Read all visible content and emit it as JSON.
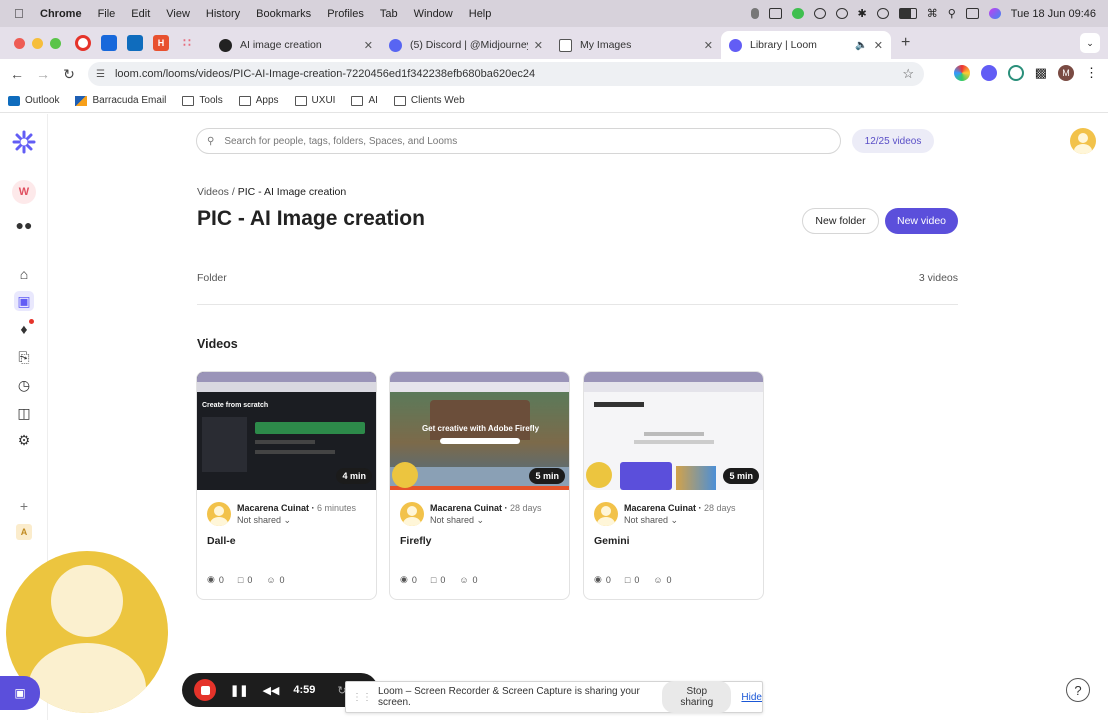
{
  "menubar": {
    "app": "Chrome",
    "items": [
      "File",
      "Edit",
      "View",
      "History",
      "Bookmarks",
      "Profiles",
      "Tab",
      "Window",
      "Help"
    ],
    "datetime": "Tue 18 Jun  09:46"
  },
  "tabs": [
    {
      "title": "AI image creation",
      "favicon_color": "#222222"
    },
    {
      "title": "(5) Discord | @Midjourney Bo",
      "favicon_color": "#5865f2"
    },
    {
      "title": "My Images",
      "favicon_color": "#555555"
    },
    {
      "title": "Library | Loom",
      "favicon_color": "#625df5",
      "active": true
    }
  ],
  "address": {
    "url": "loom.com/looms/videos/PIC-AI-Image-creation-7220456ed1f342238efb680ba620ec24"
  },
  "bookmarks": [
    {
      "label": "Outlook",
      "icon": "outlook-icon"
    },
    {
      "label": "Barracuda Email",
      "icon": "barracuda-icon"
    },
    {
      "label": "Tools",
      "icon": "folder-icon"
    },
    {
      "label": "Apps",
      "icon": "folder-icon"
    },
    {
      "label": "UXUI",
      "icon": "folder-icon"
    },
    {
      "label": "AI",
      "icon": "folder-icon"
    },
    {
      "label": "Clients Web",
      "icon": "folder-icon"
    }
  ],
  "rail": {
    "workspace_initial": "W",
    "bottom_initial": "A",
    "accent": "#625df5"
  },
  "search": {
    "placeholder": "Search for people, tags, folders, Spaces, and Looms"
  },
  "quota": "12/25 videos",
  "breadcrumb": {
    "parent": "Videos",
    "separator": "/",
    "current": "PIC - AI Image creation"
  },
  "page": {
    "title": "PIC - AI Image creation",
    "new_folder": "New folder",
    "new_video": "New video",
    "folder_label": "Folder",
    "video_count": "3 videos",
    "section_title": "Videos"
  },
  "videos": [
    {
      "title": "Dall-e",
      "owner": "Macarena Cuinat",
      "ago": "6 minutes",
      "sharing": "Not shared",
      "duration": "4 min",
      "views": "0",
      "comments": "0",
      "reactions": "0"
    },
    {
      "title": "Firefly",
      "owner": "Macarena Cuinat",
      "ago": "28 days",
      "sharing": "Not shared",
      "duration": "5 min",
      "views": "0",
      "comments": "0",
      "reactions": "0",
      "thumb_text": "Get creative with Adobe Firefly"
    },
    {
      "title": "Gemini",
      "owner": "Macarena Cuinat",
      "ago": "28 days",
      "sharing": "Not shared",
      "duration": "5 min",
      "views": "0",
      "comments": "0",
      "reactions": "0"
    }
  ],
  "dalle_thumb_text": "Create from scratch",
  "recorder": {
    "time": "4:59"
  },
  "sharebar": {
    "message": "Loom – Screen Recorder & Screen Capture is sharing your screen.",
    "stop": "Stop sharing",
    "hide": "Hide"
  },
  "help": "?"
}
